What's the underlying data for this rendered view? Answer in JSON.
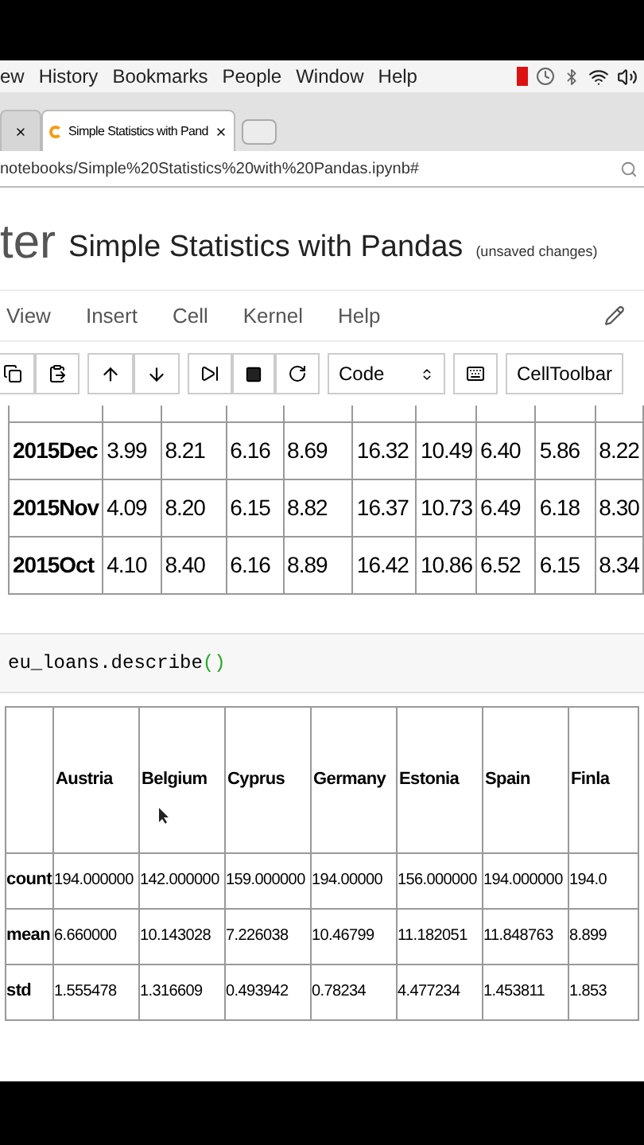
{
  "menubar": {
    "items": [
      "ew",
      "History",
      "Bookmarks",
      "People",
      "Window",
      "Help"
    ]
  },
  "tabs": [
    {
      "selected": false
    },
    {
      "label": "Simple Statistics with Pand",
      "selected": true
    }
  ],
  "address": {
    "url": "notebooks/Simple%20Statistics%20with%20Pandas.ipynb#"
  },
  "header": {
    "logo": "ter",
    "title": "Simple Statistics with Pandas",
    "status": "(unsaved changes)"
  },
  "menu": [
    "View",
    "Insert",
    "Cell",
    "Kernel",
    "Help"
  ],
  "toolbar": {
    "cell_type": "Code",
    "celltoolbar": "CellToolbar"
  },
  "table_1": {
    "rows": [
      [
        "2015Dec",
        "3.99",
        "8.21",
        "6.16",
        "8.69",
        "16.32",
        "10.49",
        "6.40",
        "5.86",
        "8.22"
      ],
      [
        "2015Nov",
        "4.09",
        "8.20",
        "6.15",
        "8.82",
        "16.37",
        "10.73",
        "6.49",
        "6.18",
        "8.30"
      ],
      [
        "2015Oct",
        "4.10",
        "8.40",
        "6.16",
        "8.89",
        "16.42",
        "10.86",
        "6.52",
        "6.15",
        "8.34"
      ]
    ]
  },
  "code_cell": {
    "code": "eu_loans.describe",
    "parens": "()"
  },
  "table_2": {
    "columns": [
      "",
      "Austria",
      "Belgium",
      "Cyprus",
      "Germany",
      "Estonia",
      "Spain",
      "Finla"
    ],
    "rows": [
      [
        "count",
        "194.000000",
        "142.000000",
        "159.000000",
        "194.00000",
        "156.000000",
        "194.000000",
        "194.0"
      ],
      [
        "mean",
        "6.660000",
        "10.143028",
        "7.226038",
        "10.46799",
        "11.182051",
        "11.848763",
        "8.899"
      ],
      [
        "std",
        "1.555478",
        "1.316609",
        "0.493942",
        "0.78234",
        "4.477234",
        "1.453811",
        "1.853"
      ]
    ]
  }
}
